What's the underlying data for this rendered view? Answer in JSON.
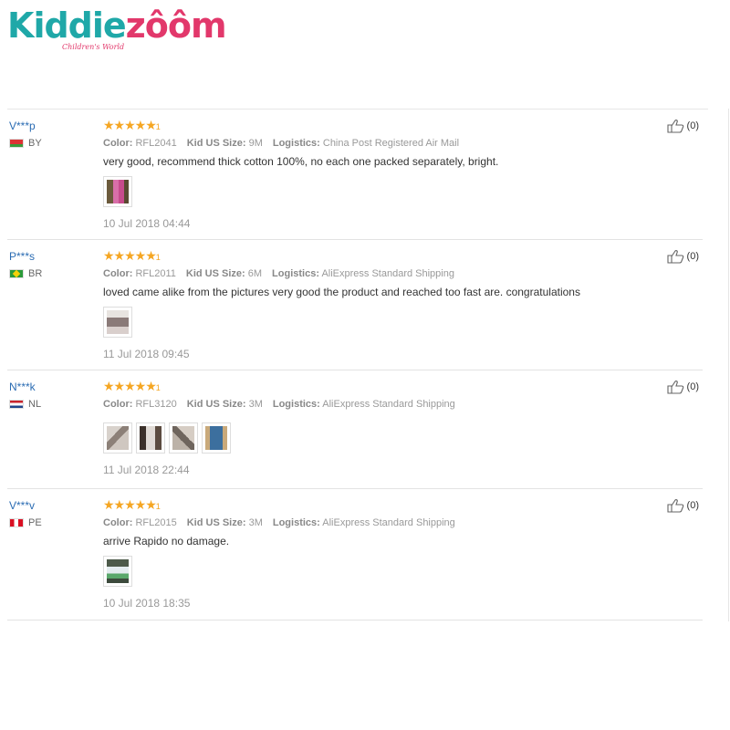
{
  "brand": {
    "logo_kiddie": "Kiddie",
    "logo_zoom": "zôôm",
    "tagline": "Children's World"
  },
  "labels": {
    "color": "Color:",
    "size": "Kid US Size:",
    "logistics": "Logistics:"
  },
  "icons": {
    "helpful": "thumbs-up-icon",
    "rating": "star-icon"
  },
  "colors": {
    "star": "#f5a623",
    "username": "#2b6cb3",
    "brand_teal": "#1fa8a8",
    "brand_pink": "#e2386b"
  },
  "reviews": [
    {
      "user": "V***p",
      "country": "BY",
      "rating": 5,
      "color": "RFL2041",
      "size": "9M",
      "logistics": "China Post Registered Air Mail",
      "text": "very good, recommend thick cotton 100%, no each one packed separately, bright.",
      "photo_count": 1,
      "date": "10 Jul 2018 04:44",
      "helpful": "(0)"
    },
    {
      "user": "P***s",
      "country": "BR",
      "rating": 5,
      "color": "RFL2011",
      "size": "6M",
      "logistics": "AliExpress Standard Shipping",
      "text": "loved came alike from the pictures very good the product and reached too fast are. congratulations",
      "photo_count": 1,
      "date": "11 Jul 2018 09:45",
      "helpful": "(0)"
    },
    {
      "user": "N***k",
      "country": "NL",
      "rating": 5,
      "color": "RFL3120",
      "size": "3M",
      "logistics": "AliExpress Standard Shipping",
      "text": "",
      "photo_count": 4,
      "date": "11 Jul 2018 22:44",
      "helpful": "(0)"
    },
    {
      "user": "V***v",
      "country": "PE",
      "rating": 5,
      "color": "RFL2015",
      "size": "3M",
      "logistics": "AliExpress Standard Shipping",
      "text": "arrive Rapido no damage.",
      "photo_count": 1,
      "date": "10 Jul 2018 18:35",
      "helpful": "(0)"
    }
  ]
}
